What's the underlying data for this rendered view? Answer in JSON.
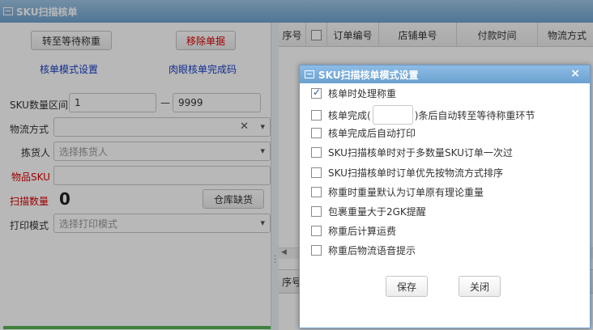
{
  "window": {
    "title": "SKU扫描核单"
  },
  "left": {
    "btn_pending_weigh": "转至等待称重",
    "btn_remove_order": "移除单据",
    "link_mode_settings": "核单模式设置",
    "link_visual_code": "肉眼核单完成码",
    "sku_range_label": "SKU数量区间",
    "sku_min": "1",
    "sku_range_sep": "—",
    "sku_max": "9999",
    "logistics_label": "物流方式",
    "picker_label": "拣货人",
    "picker_placeholder": "选择拣货人",
    "item_sku_label": "物品SKU",
    "scan_qty_label": "扫描数量",
    "scan_qty_value": "0",
    "btn_stock_shortage": "仓库缺货",
    "print_mode_label": "打印模式",
    "print_mode_placeholder": "选择打印模式"
  },
  "grid": {
    "columns": [
      "序号",
      "",
      "订单编号",
      "店铺单号",
      "付款时间",
      "物流方式"
    ],
    "bottom_first_col": "序号"
  },
  "dialog": {
    "title": "SKU扫描核单模式设置",
    "close_glyph": "×",
    "options": [
      {
        "label": "核单时处理称重",
        "checked": true
      },
      {
        "label_before": "核单完成(",
        "label_after": ")条后自动转至等待称重环节",
        "checked": false
      },
      {
        "label": "核单完成后自动打印",
        "checked": false
      },
      {
        "label": "SKU扫描核单时对于多数量SKU订单一次过",
        "checked": false
      },
      {
        "label": "SKU扫描核单时订单优先按物流方式排序",
        "checked": false
      },
      {
        "label": "称重时重量默认为订单原有理论重量",
        "checked": false
      },
      {
        "label": "包裹重量大于2GK提醒",
        "checked": false
      },
      {
        "label": "称重后计算运费",
        "checked": false
      },
      {
        "label": "称重后物流语音提示",
        "checked": false
      }
    ],
    "save_label": "保存",
    "close_label": "关闭"
  },
  "colors": {
    "title_bar": "#6ea3cf",
    "link": "#1740c8",
    "warn": "#dd0000",
    "progress": "#55b555"
  }
}
